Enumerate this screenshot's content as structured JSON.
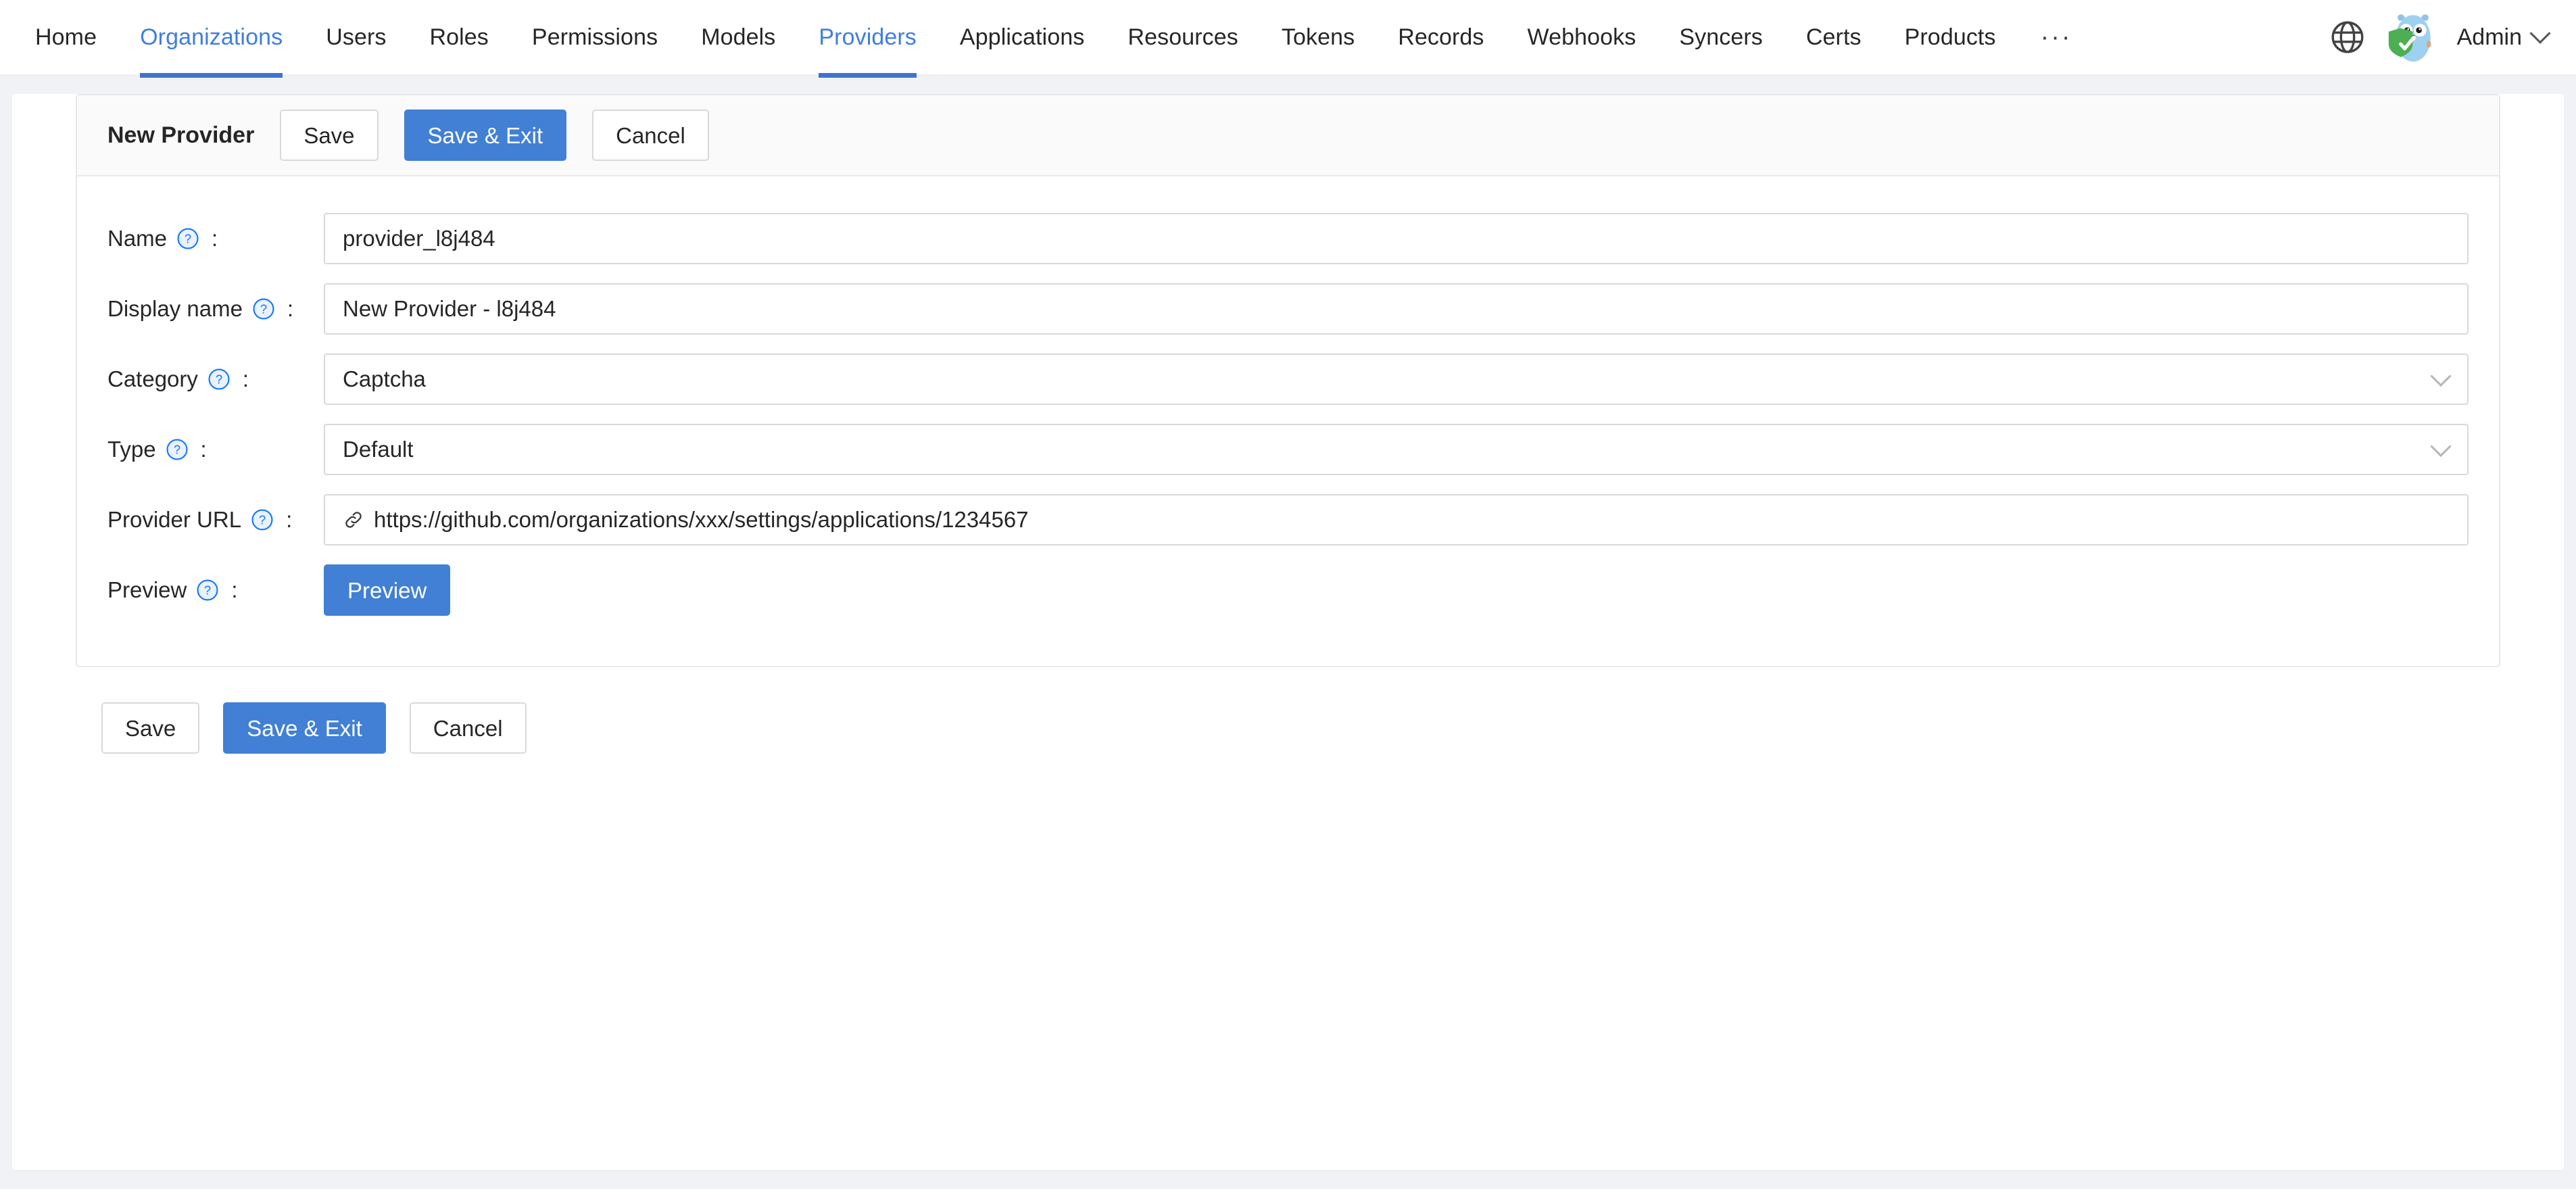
{
  "nav": {
    "items": [
      {
        "label": "Home",
        "active": false
      },
      {
        "label": "Organizations",
        "active": true
      },
      {
        "label": "Users",
        "active": false
      },
      {
        "label": "Roles",
        "active": false
      },
      {
        "label": "Permissions",
        "active": false
      },
      {
        "label": "Models",
        "active": false
      },
      {
        "label": "Providers",
        "active": true
      },
      {
        "label": "Applications",
        "active": false
      },
      {
        "label": "Resources",
        "active": false
      },
      {
        "label": "Tokens",
        "active": false
      },
      {
        "label": "Records",
        "active": false
      },
      {
        "label": "Webhooks",
        "active": false
      },
      {
        "label": "Syncers",
        "active": false
      },
      {
        "label": "Certs",
        "active": false
      },
      {
        "label": "Products",
        "active": false
      }
    ],
    "overflow_label": "···",
    "language_icon": "globe-icon",
    "avatar_icon": "casdoor-gopher-shield-avatar",
    "username": "Admin",
    "user_caret_icon": "chevron-down-icon",
    "accent_color": "#3f72d1",
    "active_text_color": "#3f7ee0"
  },
  "card": {
    "title": "New Provider",
    "top_actions": [
      {
        "label": "Save",
        "primary": false
      },
      {
        "label": "Save & Exit",
        "primary": true
      },
      {
        "label": "Cancel",
        "primary": false
      }
    ],
    "bottom_actions": [
      {
        "label": "Save",
        "primary": false
      },
      {
        "label": "Save & Exit",
        "primary": true
      },
      {
        "label": "Cancel",
        "primary": false
      }
    ]
  },
  "form": {
    "help_icon": "question-circle-icon",
    "colon": ":",
    "fields": {
      "name": {
        "label": "Name",
        "value": "provider_l8j484",
        "placeholder": ""
      },
      "display_name": {
        "label": "Display name",
        "value": "New Provider - l8j484",
        "placeholder": ""
      },
      "category": {
        "label": "Category",
        "value": "Captcha",
        "chevron_icon": "chevron-down-icon"
      },
      "type": {
        "label": "Type",
        "value": "Default",
        "chevron_icon": "chevron-down-icon"
      },
      "provider_url": {
        "label": "Provider URL",
        "value": "https://github.com/organizations/xxx/settings/applications/1234567",
        "link_icon": "link-icon"
      },
      "preview": {
        "label": "Preview",
        "button_label": "Preview"
      }
    }
  },
  "colors": {
    "primary": "#4180d4",
    "page_bg": "#f0f2f5",
    "card_bg": "#ffffff",
    "head_bg": "#fafafa",
    "border": "#e8e8e8",
    "input_border": "#d9d9d9",
    "help_blue": "#1677ff"
  }
}
